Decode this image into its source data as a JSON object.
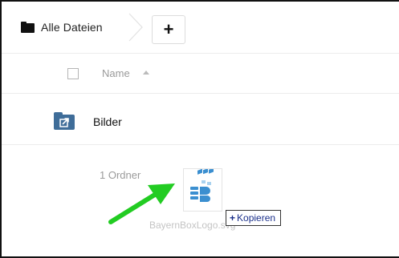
{
  "breadcrumb": {
    "root_label": "Alle Dateien",
    "root_icon": "folder-icon"
  },
  "toolbar": {
    "add_label": "+"
  },
  "file_list": {
    "columns": [
      {
        "label": "Name",
        "sort": "ascending"
      }
    ],
    "rows": [
      {
        "name": "Bilder",
        "icon": "shared-folder-icon"
      }
    ],
    "summary": "1 Ordner"
  },
  "drag_preview": {
    "file_name": "BayernBoxLogo.svg",
    "tooltip_icon": "+",
    "tooltip_label": "Kopieren"
  },
  "colors": {
    "folder_blue": "#3f6d99",
    "arrow_green": "#22cc22",
    "tooltip_text": "#1a2f8a",
    "logo_blue": "#3b8fd0"
  }
}
